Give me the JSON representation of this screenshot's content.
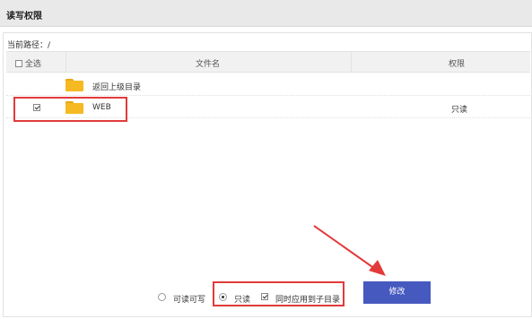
{
  "header": {
    "title": "读写权限"
  },
  "path": {
    "label": "当前路径：/"
  },
  "table": {
    "select_all_label": "全选",
    "col_filename": "文件名",
    "col_permission": "权限",
    "rows": [
      {
        "name": "返回上级目录",
        "permission": "",
        "checked": false,
        "has_checkbox": false
      },
      {
        "name": "WEB",
        "permission": "只读",
        "checked": true,
        "has_checkbox": true
      }
    ]
  },
  "options": {
    "read_write_label": "可读可写",
    "read_only_label": "只读",
    "apply_subdirs_label": "同时应用到子目录",
    "selected": "read_only",
    "apply_subdirs_checked": true
  },
  "modify_button": {
    "label": "修改"
  },
  "colors": {
    "annotation": "#e23a3a",
    "button": "#4659bf",
    "folder": "#f5b921"
  }
}
